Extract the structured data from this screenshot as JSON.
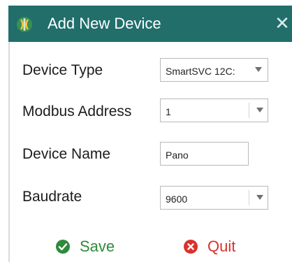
{
  "dialog": {
    "title": "Add New Device",
    "close_glyph": "✕",
    "title_icon": "device-app-icon",
    "title_bar_color": "#216e6b"
  },
  "form": {
    "device_type": {
      "label": "Device Type",
      "value": "SmartSVC 12C:",
      "control": "dropdown"
    },
    "modbus_address": {
      "label": "Modbus Address",
      "value": "1",
      "control": "combo"
    },
    "device_name": {
      "label": "Device Name",
      "value": "Pano",
      "control": "text"
    },
    "baudrate": {
      "label": "Baudrate",
      "value": "9600",
      "control": "combo"
    }
  },
  "actions": {
    "save": {
      "label": "Save",
      "icon": "check-circle-icon",
      "color": "#2f8a3c"
    },
    "quit": {
      "label": "Quit",
      "icon": "x-circle-icon",
      "color": "#d8322c"
    }
  }
}
